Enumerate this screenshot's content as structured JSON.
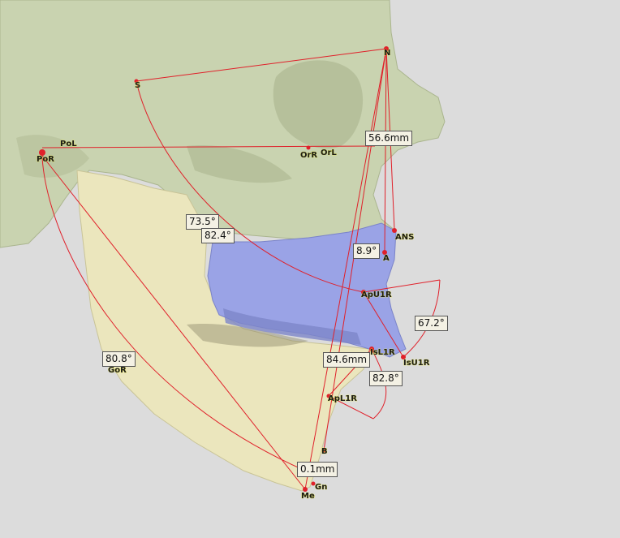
{
  "colors": {
    "background": "#dcdcdc",
    "skull": "#c9d3b0",
    "mandible": "#ebe6bd",
    "maxilla": "#9aa3e6",
    "tracing": "#e0202a",
    "landmark": "#e0202a"
  },
  "landmarks": {
    "N": "N",
    "S": "S",
    "PoL": "PoL",
    "PoR": "PoR",
    "OrR": "OrR",
    "OrL": "OrL",
    "ANS": "ANS",
    "A": "A",
    "ApU1R": "ApU1R",
    "IsL1R": "IsL1R",
    "IsU1R": "IsU1R",
    "ApL1R": "ApL1R",
    "GoR": "GoR",
    "B": "B",
    "Gn": "Gn",
    "Me": "Me"
  },
  "measurements": {
    "n_distance": "56.6mm",
    "angle_sna": "73.5°",
    "angle_snb": "82.4°",
    "angle_ans": "8.9°",
    "angle_u1": "67.2°",
    "angle_gonial": "80.8°",
    "distance_l1": "84.6mm",
    "angle_l1": "82.8°",
    "distance_b": "0.1mm"
  }
}
